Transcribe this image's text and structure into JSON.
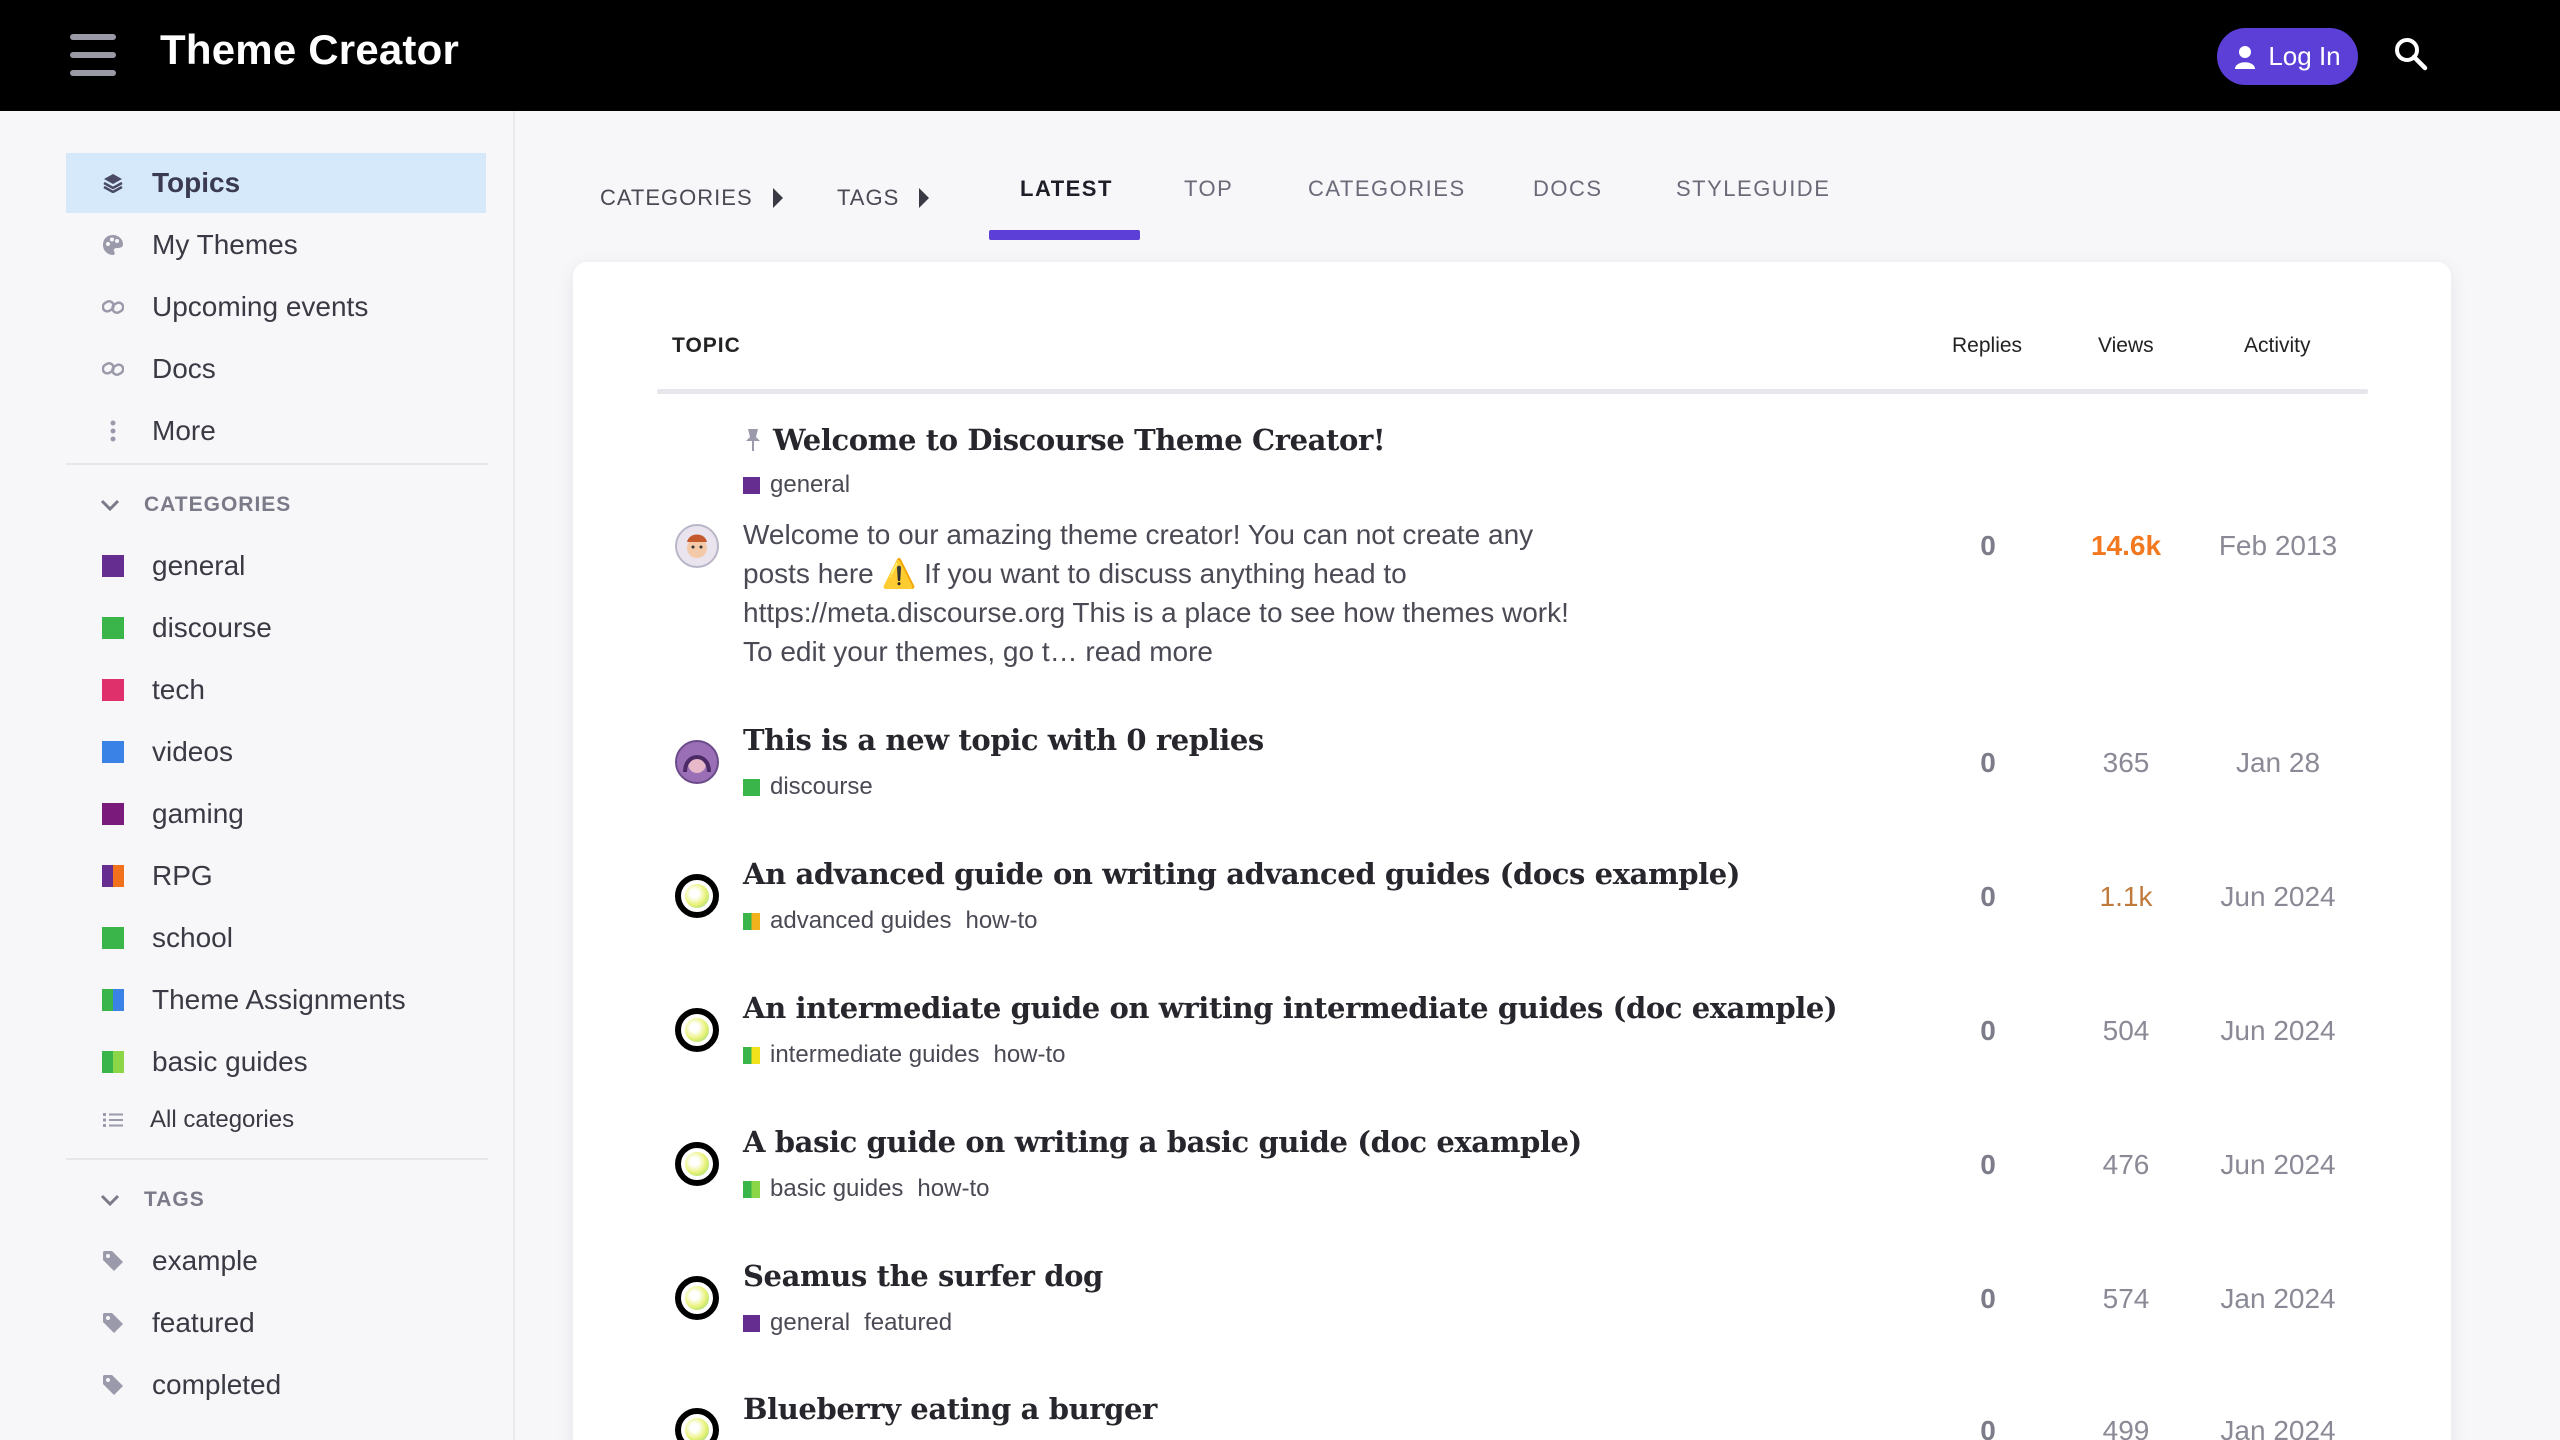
{
  "header": {
    "title": "Theme Creator",
    "login_label": "Log In"
  },
  "sidebar": {
    "main_items": [
      {
        "label": "Topics",
        "icon": "layers-icon",
        "active": true
      },
      {
        "label": "My Themes",
        "icon": "palette-icon"
      },
      {
        "label": "Upcoming events",
        "icon": "link-icon"
      },
      {
        "label": "Docs",
        "icon": "link-icon"
      },
      {
        "label": "More",
        "icon": "vertical-ellipsis-icon"
      }
    ],
    "categories_heading": "CATEGORIES",
    "categories": [
      {
        "label": "general",
        "color": "#652d90"
      },
      {
        "label": "discourse",
        "color": "#3ab54a"
      },
      {
        "label": "tech",
        "color": "#e0306b"
      },
      {
        "label": "videos",
        "color": "#3a82e6"
      },
      {
        "label": "gaming",
        "color": "#7a1a7a"
      },
      {
        "label": "RPG",
        "colors": [
          "#652d90",
          "#f2711c"
        ]
      },
      {
        "label": "school",
        "color": "#3ab54a"
      },
      {
        "label": "Theme Assignments",
        "colors": [
          "#3ab54a",
          "#3a82e6"
        ]
      },
      {
        "label": "basic guides",
        "colors": [
          "#3ab54a",
          "#8bd646"
        ]
      }
    ],
    "all_categories_label": "All categories",
    "tags_heading": "TAGS",
    "tags": [
      {
        "label": "example"
      },
      {
        "label": "featured"
      },
      {
        "label": "completed"
      }
    ]
  },
  "nav": {
    "categories_drop": "CATEGORIES",
    "tags_drop": "TAGS",
    "tabs": [
      "LATEST",
      "TOP",
      "CATEGORIES",
      "DOCS",
      "STYLEGUIDE"
    ],
    "active_tab": "LATEST"
  },
  "table": {
    "headers": {
      "topic": "TOPIC",
      "replies": "Replies",
      "views": "Views",
      "activity": "Activity"
    },
    "rows": [
      {
        "title": "Welcome to Discourse Theme Creator!",
        "pinned": true,
        "category": "general",
        "category_color": "#652d90",
        "tags": [],
        "excerpt": "Welcome to our amazing theme creator! You can not create any posts here ⚠️ If you want to discuss anything head to https://meta.discourse.org This is a place to see how themes work! To edit your themes, go t…",
        "read_more": "read more",
        "replies": "0",
        "views": "14.6k",
        "activity": "Feb 2013"
      },
      {
        "title": "This is a new topic with 0 replies",
        "category": "discourse",
        "category_color": "#3ab54a",
        "tags": [],
        "replies": "0",
        "views": "365",
        "activity": "Jan 28"
      },
      {
        "title": "An advanced guide on writing advanced guides (docs example)",
        "category": "advanced guides",
        "category_colors": [
          "#3ab54a",
          "#f2b21c"
        ],
        "tags": [
          "how-to"
        ],
        "replies": "0",
        "views": "1.1k",
        "activity": "Jun 2024"
      },
      {
        "title": "An intermediate guide on writing intermediate guides (doc example)",
        "category": "intermediate guides",
        "category_colors": [
          "#3ab54a",
          "#f2e21c"
        ],
        "tags": [
          "how-to"
        ],
        "replies": "0",
        "views": "504",
        "activity": "Jun 2024"
      },
      {
        "title": "A basic guide on writing a basic guide (doc example)",
        "category": "basic guides",
        "category_colors": [
          "#3ab54a",
          "#8bd646"
        ],
        "tags": [
          "how-to"
        ],
        "replies": "0",
        "views": "476",
        "activity": "Jun 2024"
      },
      {
        "title": "Seamus the surfer dog",
        "category": "general",
        "category_color": "#652d90",
        "tags": [
          "featured"
        ],
        "replies": "0",
        "views": "574",
        "activity": "Jan 2024"
      },
      {
        "title": "Blueberry eating a burger",
        "replies": "0",
        "views": "499",
        "activity": "Jan 2024"
      }
    ]
  }
}
